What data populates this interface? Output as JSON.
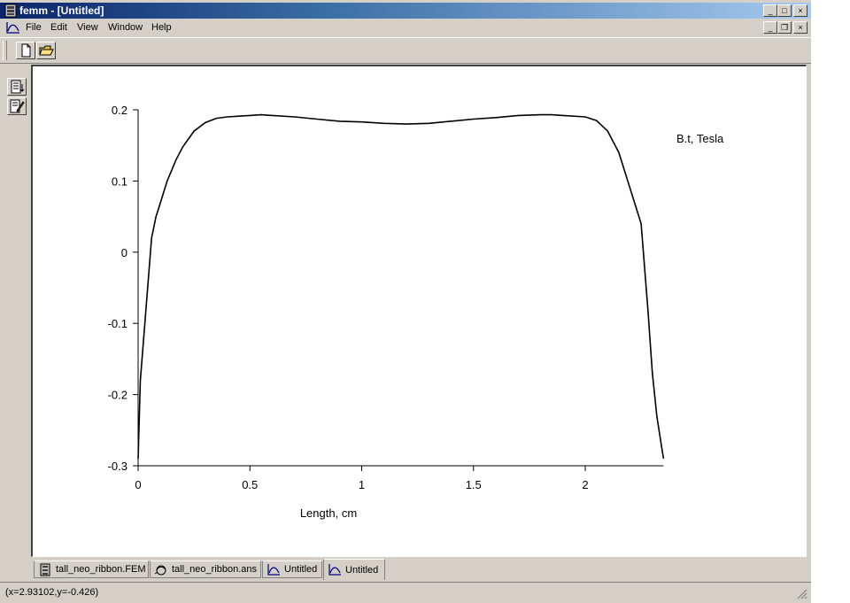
{
  "window": {
    "title": "femm - [Untitled]",
    "caption_buttons": [
      "_",
      "□",
      "×"
    ],
    "mdi_buttons": [
      "_",
      "❐",
      "×"
    ]
  },
  "menu": [
    "File",
    "Edit",
    "View",
    "Window",
    "Help"
  ],
  "toolbar": {
    "icons": [
      "new-file-icon",
      "open-folder-icon"
    ]
  },
  "sidebar": {
    "icons": [
      "list-view-icon",
      "edit-view-icon"
    ]
  },
  "chart_data": {
    "type": "line",
    "series": [
      {
        "name": "B.t, Tesla",
        "x": [
          0,
          0.01,
          0.03,
          0.06,
          0.08,
          0.1,
          0.13,
          0.17,
          0.2,
          0.25,
          0.3,
          0.35,
          0.4,
          0.45,
          0.5,
          0.55,
          0.6,
          0.7,
          0.8,
          0.9,
          1.0,
          1.1,
          1.2,
          1.3,
          1.4,
          1.5,
          1.6,
          1.7,
          1.8,
          1.85,
          1.9,
          2.0,
          2.05,
          2.1,
          2.15,
          2.2,
          2.25,
          2.28,
          2.3,
          2.32,
          2.34,
          2.35
        ],
        "values": [
          -0.29,
          -0.18,
          -0.1,
          0.02,
          0.05,
          0.07,
          0.1,
          0.13,
          0.148,
          0.17,
          0.182,
          0.188,
          0.19,
          0.191,
          0.192,
          0.193,
          0.192,
          0.19,
          0.187,
          0.184,
          0.183,
          0.181,
          0.18,
          0.181,
          0.184,
          0.187,
          0.189,
          0.192,
          0.193,
          0.193,
          0.192,
          0.19,
          0.185,
          0.17,
          0.14,
          0.09,
          0.04,
          -0.08,
          -0.17,
          -0.23,
          -0.27,
          -0.29
        ]
      }
    ],
    "annotation": "B.t, Tesla",
    "xlabel": "Length, cm",
    "ylabel": "",
    "xlim": [
      0,
      2.35
    ],
    "ylim": [
      -0.3,
      0.2
    ],
    "xticks": [
      "0",
      "0.5",
      "1",
      "1.5",
      "2"
    ],
    "yticks": [
      "0.2",
      "0.1",
      "0",
      "-0.1",
      "-0.2",
      "-0.3"
    ],
    "xtick_values": [
      0,
      0.5,
      1,
      1.5,
      2
    ],
    "ytick_values": [
      0.2,
      0.1,
      0,
      -0.1,
      -0.2,
      -0.3
    ],
    "grid": false
  },
  "tabs": [
    {
      "label": "tall_neo_ribbon.FEM",
      "icon": "magnet-doc-icon",
      "active": false
    },
    {
      "label": "tall_neo_ribbon.ans",
      "icon": "solution-doc-icon",
      "active": false
    },
    {
      "label": "Untitled",
      "icon": "plot-doc-icon",
      "active": false
    },
    {
      "label": "Untitled",
      "icon": "plot-doc-icon",
      "active": true
    }
  ],
  "status": {
    "text": "(x=2.93102,y=-0.426)"
  }
}
